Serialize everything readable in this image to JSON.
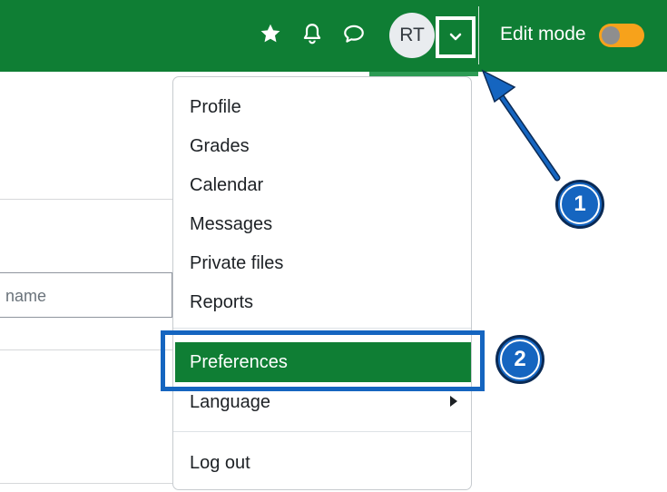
{
  "navbar": {
    "icons": [
      "star-icon",
      "bell-icon",
      "chat-bubble-icon"
    ],
    "avatar_initials": "RT",
    "edit_mode_label": "Edit mode",
    "edit_mode_on": true
  },
  "background": {
    "name_input_placeholder": "name"
  },
  "user_menu": {
    "items": [
      "Profile",
      "Grades",
      "Calendar",
      "Messages",
      "Private files",
      "Reports"
    ],
    "highlighted": "Preferences",
    "language": "Language",
    "logout": "Log out"
  },
  "callouts": {
    "step1": "1",
    "step2": "2"
  },
  "colors": {
    "navbar": "#0f7e34",
    "highlight": "#0f7e34",
    "callout": "#1565c0",
    "toggle": "#f7a21b"
  }
}
